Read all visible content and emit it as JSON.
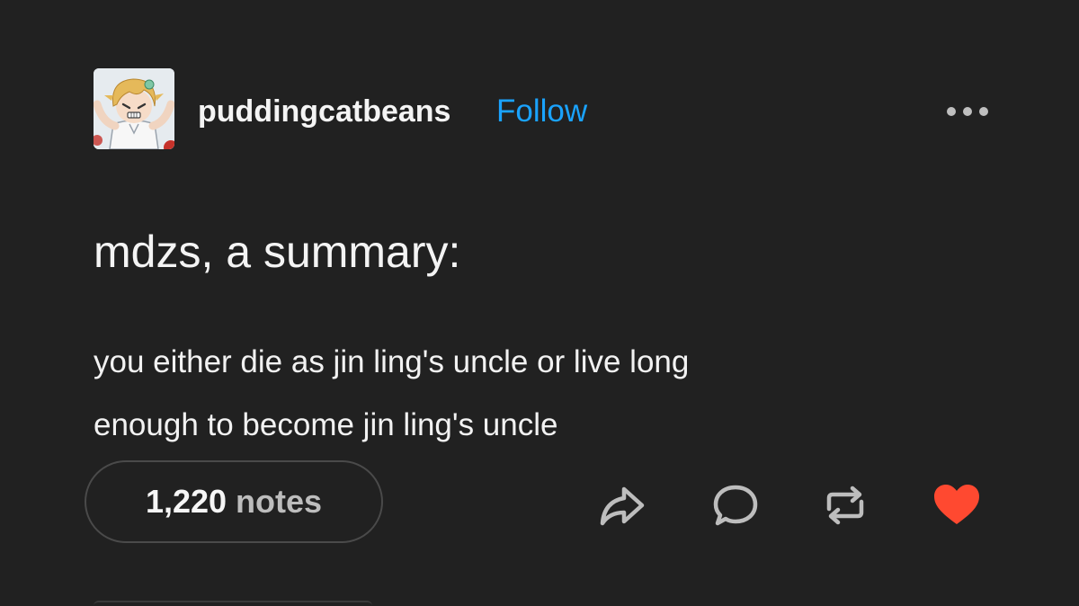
{
  "post": {
    "author": {
      "username": "puddingcatbeans",
      "follow_label": "Follow",
      "avatar_icon": "anime-avatar-icon"
    },
    "more_icon": "more-options-icon",
    "title": "mdzs, a summary:",
    "body_lines": [
      "you either die as jin ling's uncle or live long",
      "enough to become jin ling's uncle"
    ],
    "notes": {
      "count": "1,220",
      "label": "notes"
    },
    "actions": {
      "share_icon": "share-icon",
      "reply_icon": "reply-icon",
      "reblog_icon": "reblog-icon",
      "like_icon": "heart-icon"
    },
    "colors": {
      "background": "#212121",
      "follow": "#1aa3ff",
      "heart": "#ff4930",
      "text": "#f2f2f2"
    }
  }
}
